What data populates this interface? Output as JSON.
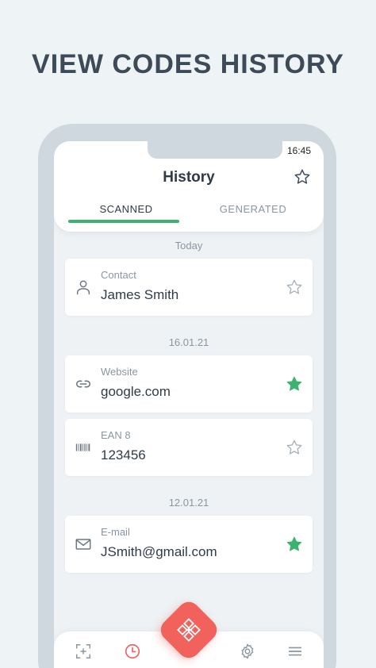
{
  "promo": {
    "title": "VIEW CODES HISTORY"
  },
  "status_bar": {
    "time": "16:45"
  },
  "header": {
    "title": "History",
    "tabs": [
      {
        "label": "SCANNED",
        "active": true
      },
      {
        "label": "GENERATED",
        "active": false
      }
    ]
  },
  "groups": [
    {
      "date": "Today"
    },
    {
      "date": "16.01.21"
    },
    {
      "date": "12.01.21"
    }
  ],
  "items": [
    {
      "type": "Contact",
      "value": "James Smith",
      "icon": "person-icon",
      "favorite": false
    },
    {
      "type": "Website",
      "value": "google.com",
      "icon": "link-icon",
      "favorite": true
    },
    {
      "type": "EAN 8",
      "value": "123456",
      "icon": "barcode-icon",
      "favorite": false
    },
    {
      "type": "E-mail",
      "value": "JSmith@gmail.com",
      "icon": "mail-icon",
      "favorite": true
    }
  ],
  "nav": {
    "items": [
      "create-icon",
      "history-icon",
      "scan-icon",
      "settings-icon",
      "menu-icon"
    ]
  },
  "colors": {
    "accent": "#3bb36e",
    "fab": "#f0625b",
    "active_nav": "#f0625b",
    "text": "#2f3b47",
    "muted": "#8a96a1"
  }
}
